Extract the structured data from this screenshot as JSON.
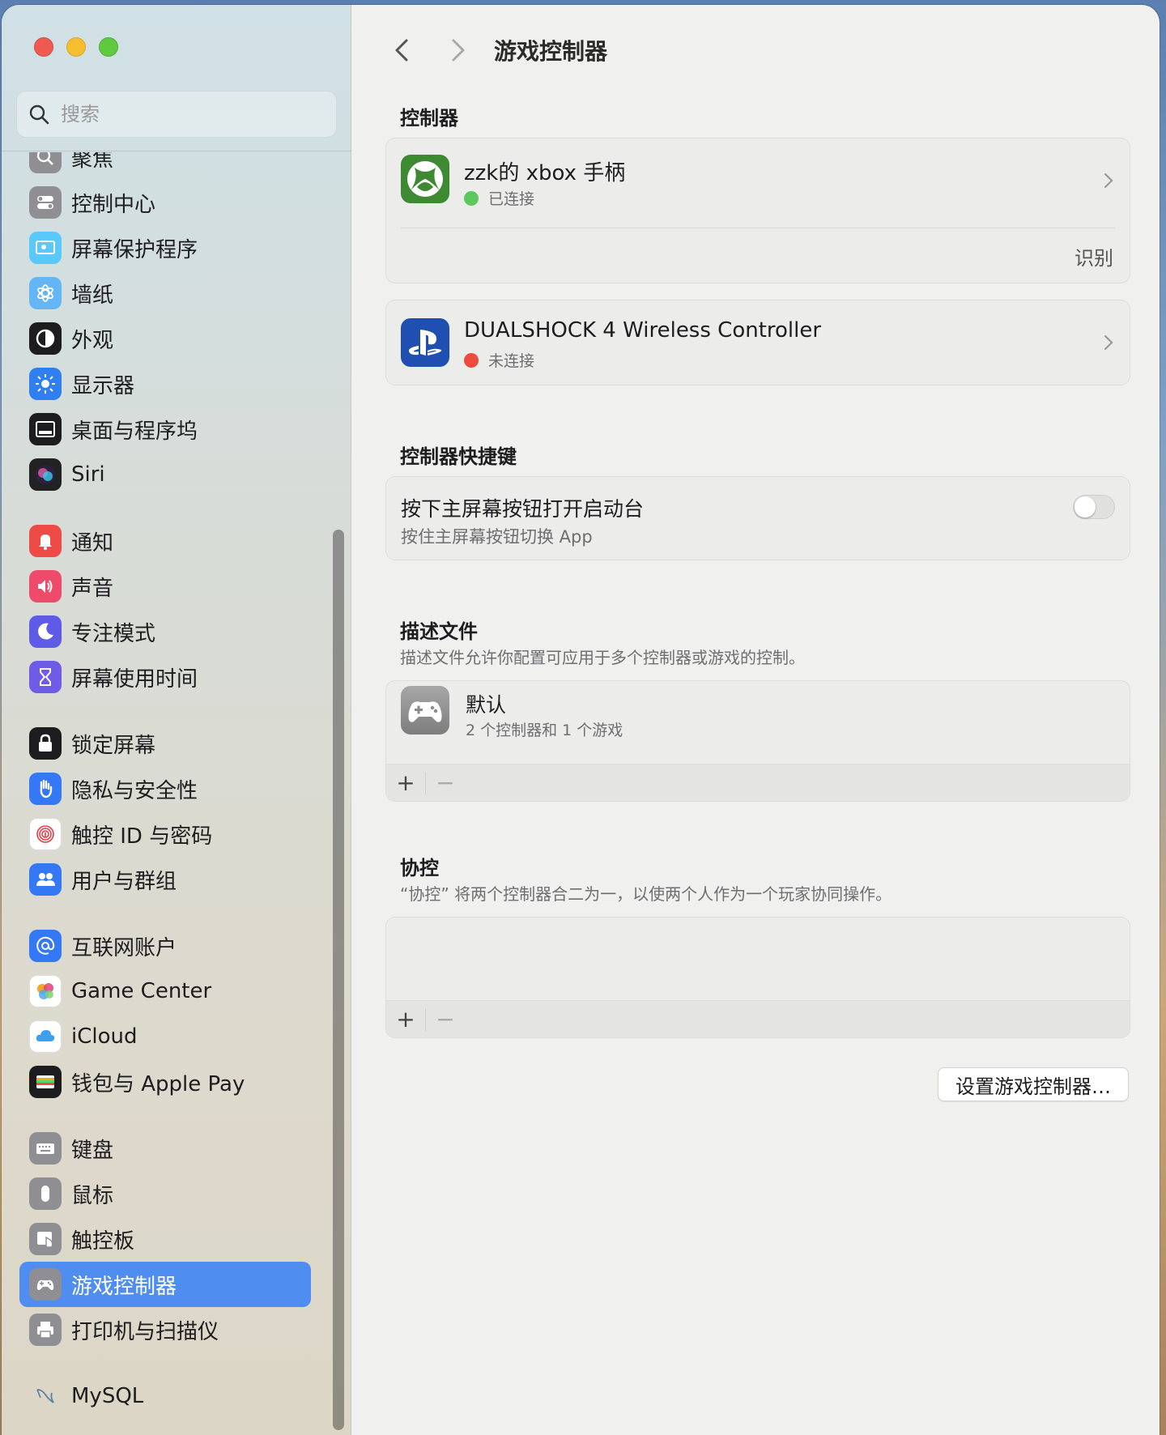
{
  "search": {
    "placeholder": "搜索"
  },
  "sidebar": {
    "items": [
      {
        "label": "聚焦",
        "icon": "search-icon",
        "color": "#8e8e93",
        "group": 0
      },
      {
        "label": "控制中心",
        "icon": "toggles-icon",
        "color": "#8e8e93",
        "group": 0
      },
      {
        "label": "屏幕保护程序",
        "icon": "screensaver-icon",
        "color": "#5ac8fa",
        "group": 0
      },
      {
        "label": "墙纸",
        "icon": "flower-icon",
        "color": "#64b5f6",
        "group": 0
      },
      {
        "label": "外观",
        "icon": "appearance-icon",
        "color": "#1d1d1f",
        "group": 0
      },
      {
        "label": "显示器",
        "icon": "sun-icon",
        "color": "#2f7ff0",
        "group": 0
      },
      {
        "label": "桌面与程序坞",
        "icon": "dock-icon",
        "color": "#1d1d1f",
        "group": 0
      },
      {
        "label": "Siri",
        "icon": "siri-icon",
        "color": "#222222",
        "group": 0
      },
      {
        "label": "通知",
        "icon": "bell-icon",
        "color": "#ee4b46",
        "group": 1
      },
      {
        "label": "声音",
        "icon": "speaker-icon",
        "color": "#ee4b6a",
        "group": 1
      },
      {
        "label": "专注模式",
        "icon": "moon-icon",
        "color": "#5e5ce6",
        "group": 1
      },
      {
        "label": "屏幕使用时间",
        "icon": "hourglass-icon",
        "color": "#6e5ce6",
        "group": 1
      },
      {
        "label": "锁定屏幕",
        "icon": "lock-icon",
        "color": "#1d1d1f",
        "group": 2
      },
      {
        "label": "隐私与安全性",
        "icon": "hand-icon",
        "color": "#3478f6",
        "group": 2
      },
      {
        "label": "触控 ID 与密码",
        "icon": "fingerprint-icon",
        "color": "#ffffff",
        "group": 2
      },
      {
        "label": "用户与群组",
        "icon": "users-icon",
        "color": "#3478f6",
        "group": 2
      },
      {
        "label": "互联网账户",
        "icon": "at-icon",
        "color": "#3478f6",
        "group": 3
      },
      {
        "label": "Game Center",
        "icon": "game-center-icon",
        "color": "#ffffff",
        "group": 3
      },
      {
        "label": "iCloud",
        "icon": "cloud-icon",
        "color": "#ffffff",
        "group": 3
      },
      {
        "label": "钱包与 Apple Pay",
        "icon": "wallet-icon",
        "color": "#1d1d1f",
        "group": 3
      },
      {
        "label": "键盘",
        "icon": "keyboard-icon",
        "color": "#8e8e93",
        "group": 4
      },
      {
        "label": "鼠标",
        "icon": "mouse-icon",
        "color": "#8e8e93",
        "group": 4
      },
      {
        "label": "触控板",
        "icon": "trackpad-icon",
        "color": "#8e8e93",
        "group": 4
      },
      {
        "label": "游戏控制器",
        "icon": "gamepad-icon",
        "color": "#8e8e93",
        "group": 4,
        "selected": true
      },
      {
        "label": "打印机与扫描仪",
        "icon": "printer-icon",
        "color": "#8e8e93",
        "group": 4
      },
      {
        "label": "MySQL",
        "icon": "mysql-icon",
        "color": "transparent",
        "group": 5
      }
    ]
  },
  "main": {
    "title": "游戏控制器",
    "controllers_title": "控制器",
    "controllers": [
      {
        "name": "zzk的 xbox 手柄",
        "status": "已连接",
        "status_color": "#5ac85a",
        "icon": "xbox-icon",
        "icon_color": "#3d8a33",
        "action": "识别"
      },
      {
        "name": "DUALSHOCK 4 Wireless Controller",
        "status": "未连接",
        "status_color": "#ee4b3e",
        "icon": "playstation-icon",
        "icon_color": "#1f4fb0"
      }
    ],
    "shortcuts_title": "控制器快捷键",
    "shortcut": {
      "title": "按下主屏幕按钮打开启动台",
      "subtitle": "按住主屏幕按钮切换 App",
      "enabled": false
    },
    "profiles_title": "描述文件",
    "profiles_desc": "描述文件允许你配置可应用于多个控制器或游戏的控制。",
    "profile": {
      "name": "默认",
      "detail": "2 个控制器和 1 个游戏"
    },
    "buddy_title": "协控",
    "buddy_desc": "“协控” 将两个控制器合二为一，以使两个人作为一个玩家协同操作。",
    "add_label": "+",
    "remove_label": "−",
    "setup_button": "设置游戏控制器…"
  }
}
